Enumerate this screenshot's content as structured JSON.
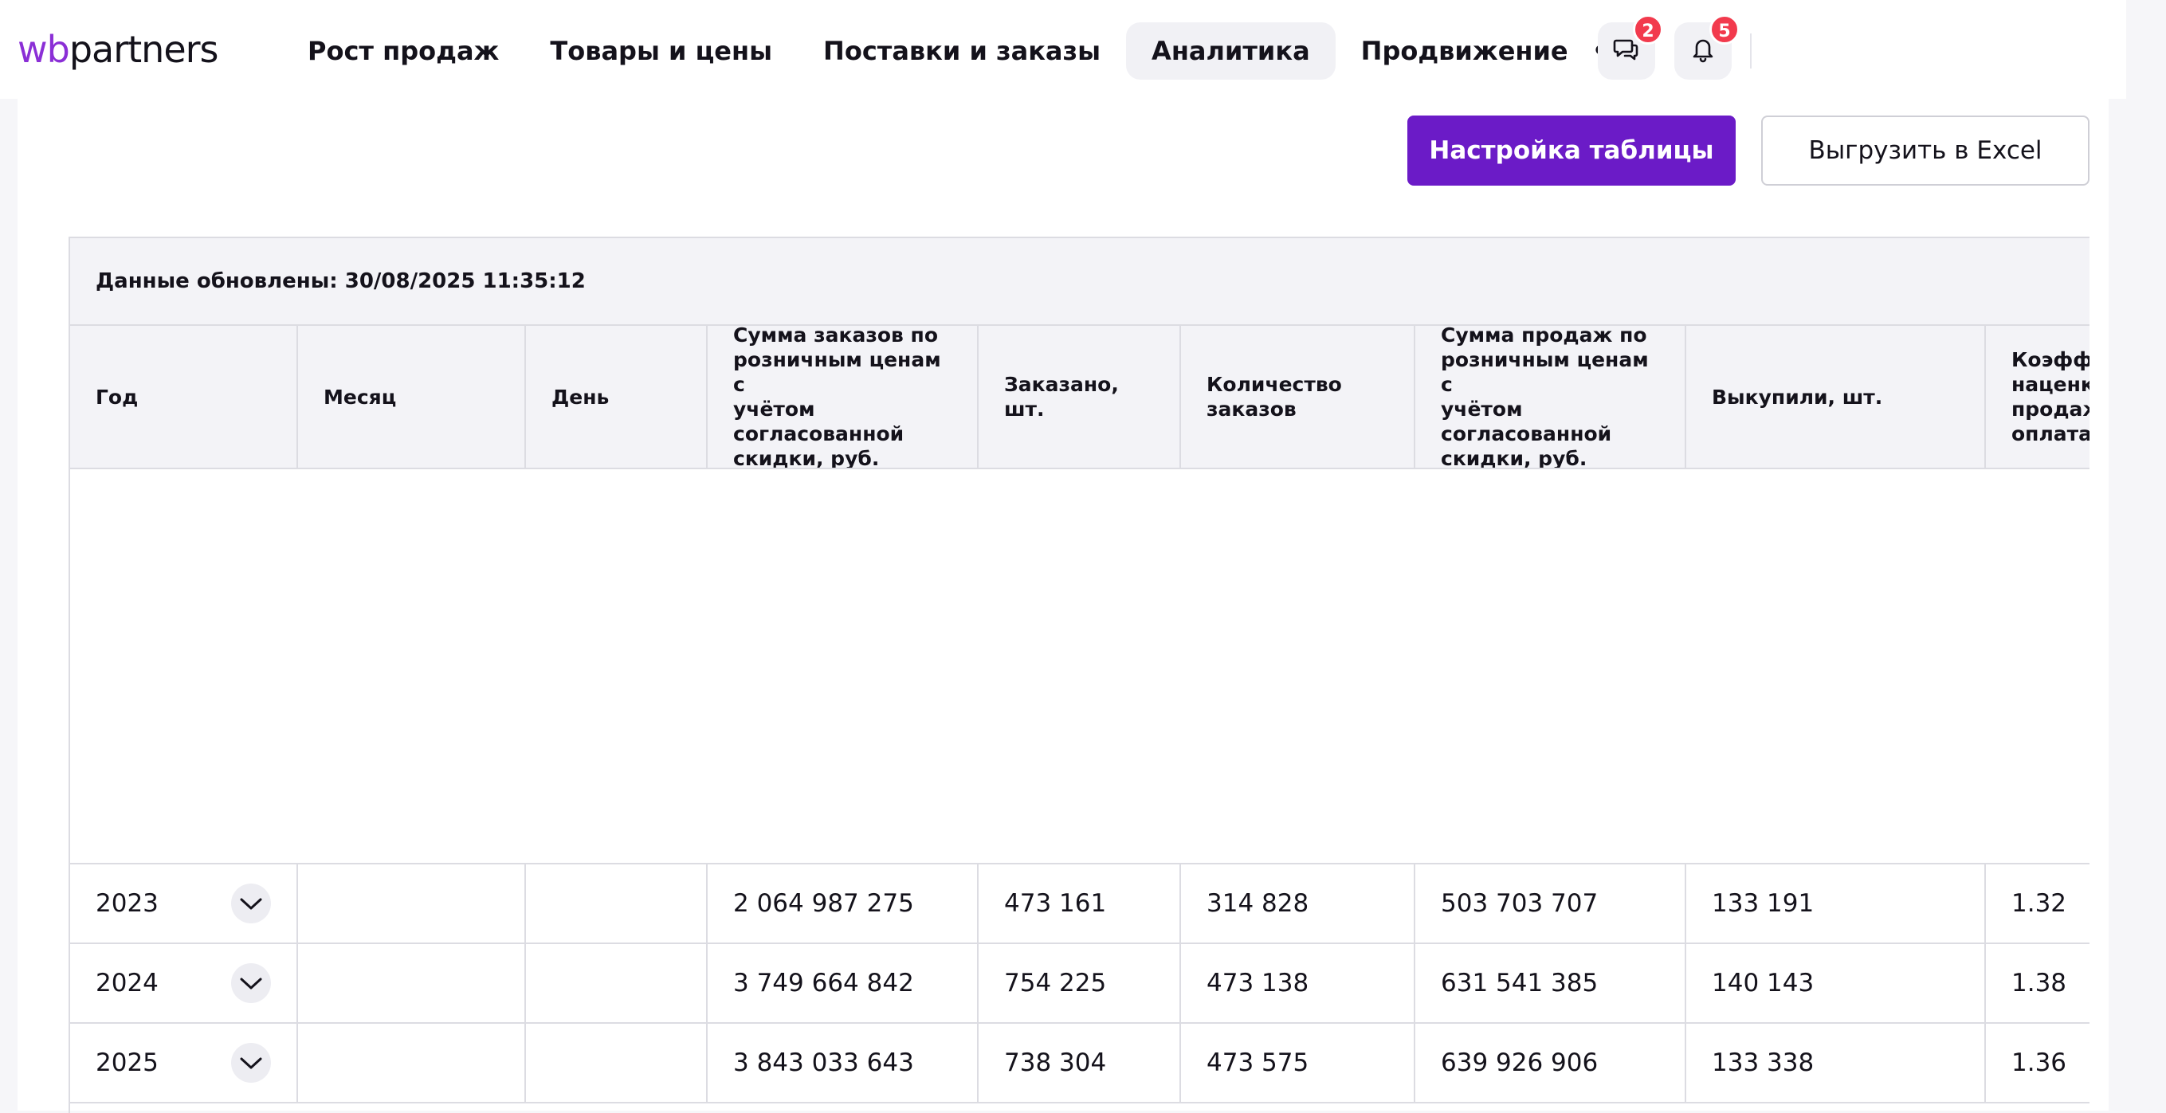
{
  "header": {
    "logo_wb": "wb",
    "logo_partners": "partners",
    "nav": [
      {
        "label": "Рост продаж",
        "active": false
      },
      {
        "label": "Товары и цены",
        "active": false
      },
      {
        "label": "Поставки и заказы",
        "active": false
      },
      {
        "label": "Аналитика",
        "active": true
      },
      {
        "label": "Продвижение",
        "active": false
      }
    ],
    "more_label": "•••",
    "chat_icon": "chat-icon",
    "chat_badge": "2",
    "bell_icon": "bell-icon",
    "bell_badge": "5"
  },
  "toolbar": {
    "settings_label": "Настройка таблицы",
    "export_label": "Выгрузить в Excel"
  },
  "table": {
    "updated": "Данные обновлены: 30/08/2025 11:35:12",
    "columns": [
      [
        "Год"
      ],
      [
        "Месяц"
      ],
      [
        "День"
      ],
      [
        "Сумма заказов по",
        "розничным ценам с",
        "учётом согласованной",
        "скидки, руб."
      ],
      [
        "Заказано, шт."
      ],
      [
        "Количество",
        "заказов"
      ],
      [
        "Сумма продаж по",
        "розничным ценам с",
        "учётом согласованной",
        "скидки, руб."
      ],
      [
        "Выкупили, шт."
      ],
      [
        "Коэффициент",
        "наценки",
        "продаж",
        "оплатам"
      ]
    ],
    "rows": [
      {
        "year": "2023",
        "month": "",
        "day": "",
        "sum_orders": "2 064 987 275",
        "ordered": "473 161",
        "orders_count": "314 828",
        "sum_sales": "503 703 707",
        "bought": "133 191",
        "coef": "1.32"
      },
      {
        "year": "2024",
        "month": "",
        "day": "",
        "sum_orders": "3 749 664 842",
        "ordered": "754 225",
        "orders_count": "473 138",
        "sum_sales": "631 541 385",
        "bought": "140 143",
        "coef": "1.38"
      },
      {
        "year": "2025",
        "month": "",
        "day": "",
        "sum_orders": "3 843 033 643",
        "ordered": "738 304",
        "orders_count": "473 575",
        "sum_sales": "639 926 906",
        "bought": "133 338",
        "coef": "1.36"
      }
    ]
  },
  "colors": {
    "accent": "#6b1bc7",
    "logo": "#8b2fd6",
    "badge": "#f23a4d"
  }
}
